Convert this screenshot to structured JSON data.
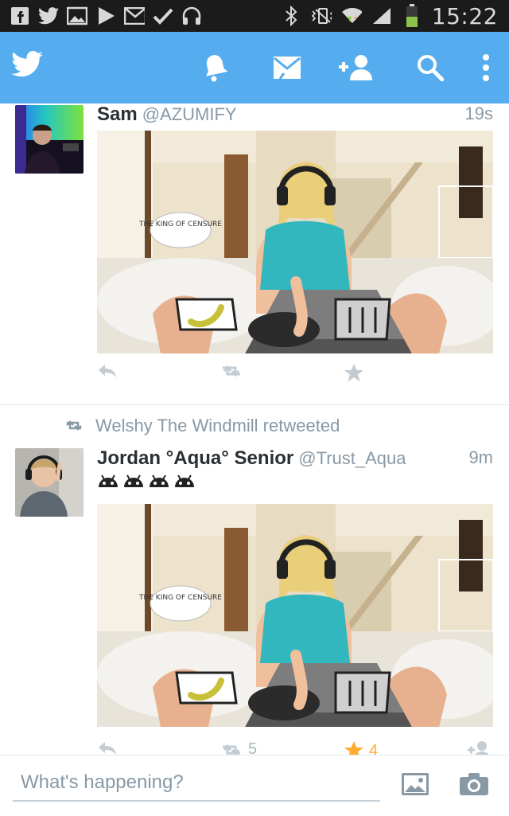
{
  "statusbar": {
    "time": "15:22",
    "left_icons": [
      "facebook-icon",
      "twitter-icon",
      "gallery-icon",
      "play-icon",
      "gmail-icon",
      "check-icon",
      "headphones-icon"
    ],
    "right_icons": [
      "bluetooth-icon",
      "vibrate-icon",
      "wifi-icon",
      "signal-icon",
      "battery-icon"
    ]
  },
  "appbar": {
    "actions": [
      "notifications-icon",
      "messages-icon",
      "add-user-icon",
      "search-icon",
      "overflow-menu-icon"
    ],
    "accent": "#55acee"
  },
  "tweets": [
    {
      "name": "Sam",
      "handle": "@AZUMIFY",
      "time": "19s",
      "media_caption": "THE KING OF CENSURE"
    },
    {
      "retweeted_by": "Welshy The Windmill retweeted",
      "name": "Jordan °Aqua° Senior",
      "handle": "@Trust_Aqua",
      "time": "9m",
      "emoji": "android-icons",
      "media_caption": "THE KING OF CENSURE",
      "retweet_count": "5",
      "favorite_count": "4"
    }
  ],
  "compose": {
    "placeholder": "What's happening?"
  }
}
